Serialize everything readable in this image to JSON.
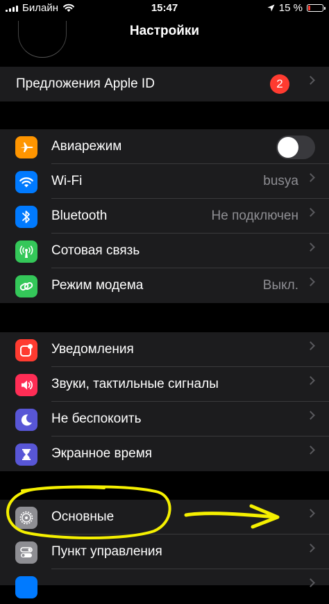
{
  "status_bar": {
    "carrier": "Билайн",
    "time": "15:47",
    "battery_text": "15 %"
  },
  "nav": {
    "title": "Настройки"
  },
  "apple_id_group": {
    "suggestion_label": "Предложения Apple ID",
    "badge_count": "2"
  },
  "connectivity": {
    "airplane": {
      "label": "Авиарежим",
      "on": false,
      "icon": "airplane-icon",
      "color": "#ff9500"
    },
    "wifi": {
      "label": "Wi-Fi",
      "value": "busya",
      "icon": "wifi-icon",
      "color": "#007aff"
    },
    "bluetooth": {
      "label": "Bluetooth",
      "value": "Не подключен",
      "icon": "bluetooth-icon",
      "color": "#007aff"
    },
    "cellular": {
      "label": "Сотовая связь",
      "icon": "antenna-icon",
      "color": "#34c759"
    },
    "hotspot": {
      "label": "Режим модема",
      "value": "Выкл.",
      "icon": "link-chain-icon",
      "color": "#34c759"
    }
  },
  "notifications_group": {
    "notifications": {
      "label": "Уведомления",
      "icon": "notifications-icon",
      "color": "#ff3b30"
    },
    "sounds": {
      "label": "Звуки, тактильные сигналы",
      "icon": "speaker-icon",
      "color": "#ff2d55"
    },
    "dnd": {
      "label": "Не беспокоить",
      "icon": "moon-icon",
      "color": "#5856d6"
    },
    "screen_time": {
      "label": "Экранное время",
      "icon": "hourglass-icon",
      "color": "#5856d6"
    }
  },
  "general_group": {
    "general": {
      "label": "Основные",
      "icon": "gear-icon",
      "color": "#8e8e93"
    },
    "control_center": {
      "label": "Пункт управления",
      "icon": "toggles-icon",
      "color": "#8e8e93"
    }
  },
  "annotation_color": "#f5f000"
}
